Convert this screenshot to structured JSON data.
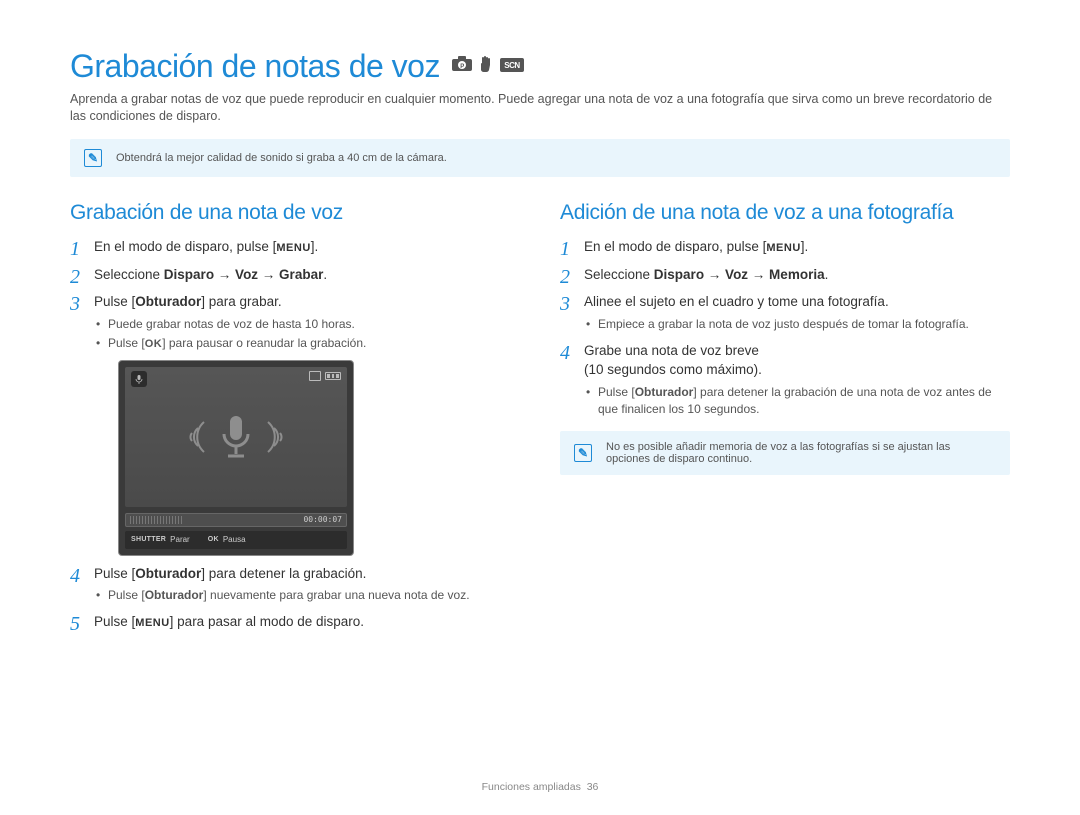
{
  "title": "Grabación de notas de voz",
  "intro": "Aprenda a grabar notas de voz que puede reproducir en cualquier momento. Puede agregar una nota de voz a una fotografía que sirva como un breve recordatorio de las condiciones de disparo.",
  "note_top": "Obtendrá la mejor calidad de sonido si graba a 40 cm de la cámara.",
  "left": {
    "heading": "Grabación de una nota de voz",
    "step1_a": "En el modo de disparo, pulse [",
    "step1_b": "].",
    "step2_a": "Seleccione ",
    "step2_b": "Disparo → Voz → Grabar",
    "step2_c": ".",
    "step3_a": "Pulse [",
    "step3_b": "Obturador",
    "step3_c": "] para grabar.",
    "step3_sub1": "Puede grabar notas de voz de hasta 10 horas.",
    "step3_sub2_a": "Pulse [",
    "step3_sub2_b": "] para pausar o reanudar la grabación.",
    "step4_a": "Pulse [",
    "step4_b": "Obturador",
    "step4_c": "] para detener la grabación.",
    "step4_sub1_a": "Pulse [",
    "step4_sub1_b": "Obturador",
    "step4_sub1_c": "] nuevamente para grabar una nueva nota de voz.",
    "step5_a": "Pulse [",
    "step5_b": "] para pasar al modo de disparo."
  },
  "device": {
    "time": "00:00:07",
    "shutter_key": "SHUTTER",
    "stop_label": "Parar",
    "ok_key": "OK",
    "pause_label": "Pausa"
  },
  "right": {
    "heading": "Adición de una nota de voz a una fotografía",
    "step1_a": "En el modo de disparo, pulse [",
    "step1_b": "].",
    "step2_a": "Seleccione ",
    "step2_b": "Disparo → Voz → Memoria",
    "step2_c": ".",
    "step3": "Alinee el sujeto en el cuadro y tome una fotografía.",
    "step3_sub1": "Empiece a grabar la nota de voz justo después de tomar la fotografía.",
    "step4_line1": "Grabe una nota de voz breve",
    "step4_line2": "(10 segundos como máximo).",
    "step4_sub1_a": "Pulse [",
    "step4_sub1_b": "Obturador",
    "step4_sub1_c": "] para detener la grabación de una nota de voz antes de que finalicen los 10 segundos.",
    "note_bottom": "No es posible añadir memoria de voz a las fotografías si se ajustan las opciones de disparo continuo."
  },
  "footer": {
    "section": "Funciones ampliadas",
    "page": "36"
  }
}
